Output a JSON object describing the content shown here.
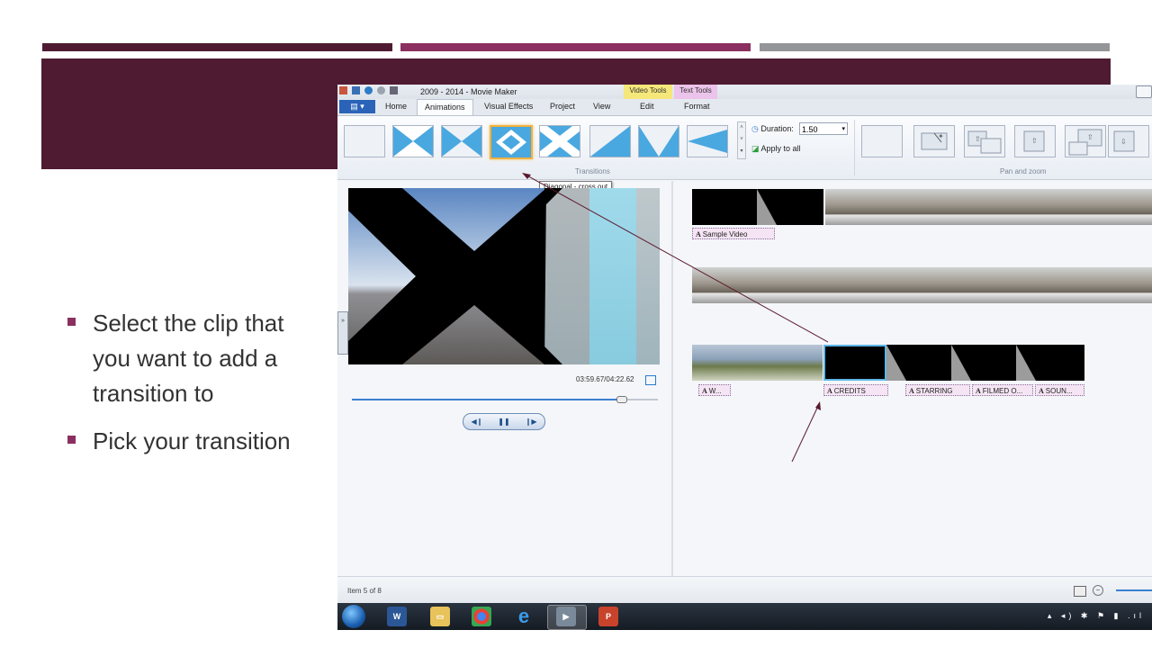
{
  "slide": {
    "bullets": [
      "Select the clip that you want to add a transition to",
      "Pick your transition"
    ],
    "colors": {
      "dark": "#4f1b32",
      "accent": "#8a2f5f",
      "gray": "#939598"
    }
  },
  "app": {
    "window_title": "2009 - 2014 - Movie Maker",
    "context_tabs": {
      "video_tools": "Video Tools",
      "text_tools": "Text Tools"
    },
    "tabs": [
      "Home",
      "Animations",
      "Visual Effects",
      "Project",
      "View",
      "Edit",
      "Format"
    ],
    "active_tab": "Animations",
    "ribbon": {
      "transitions_group": "Transitions",
      "duration_label": "Duration:",
      "duration_value": "1.50",
      "apply_all": "Apply to all",
      "pan_zoom_group": "Pan and zoom",
      "selected_transition_tooltip": "Diagonal - cross out"
    },
    "preview": {
      "timecode": "03:59.67/04:22.62",
      "progress": 0.88
    },
    "timeline": {
      "captions": [
        "Sample Video",
        "W...",
        "CREDITS",
        "STARRING",
        "FILMED O...",
        "SOUN..."
      ]
    },
    "status_text": "Item 5 of 8",
    "taskbar_icons": [
      "windows-start-icon",
      "word-icon",
      "file-explorer-icon",
      "chrome-icon",
      "internet-explorer-icon",
      "movie-maker-icon",
      "powerpoint-icon"
    ]
  }
}
